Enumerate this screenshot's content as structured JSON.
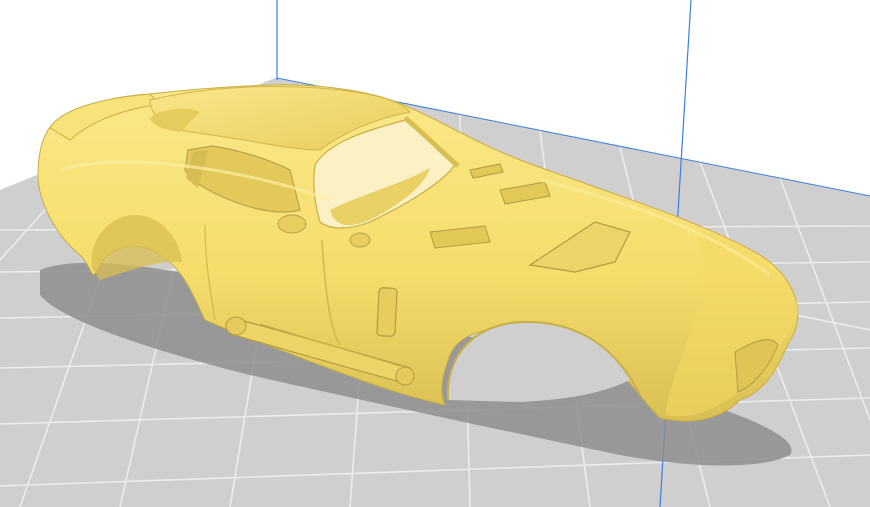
{
  "viewport": {
    "background_color": "#ffffff",
    "build_plate_color": "#c9c9c9",
    "grid_line_color": "#e6e6e6",
    "build_volume_edge_color": "#3a7fe0",
    "model_color": "#f6dd6c",
    "model_shadow_color": "#b8a24d",
    "model_drop_shadow_color": "#8e8e8e"
  },
  "model": {
    "name_icon": "car-body-model"
  }
}
